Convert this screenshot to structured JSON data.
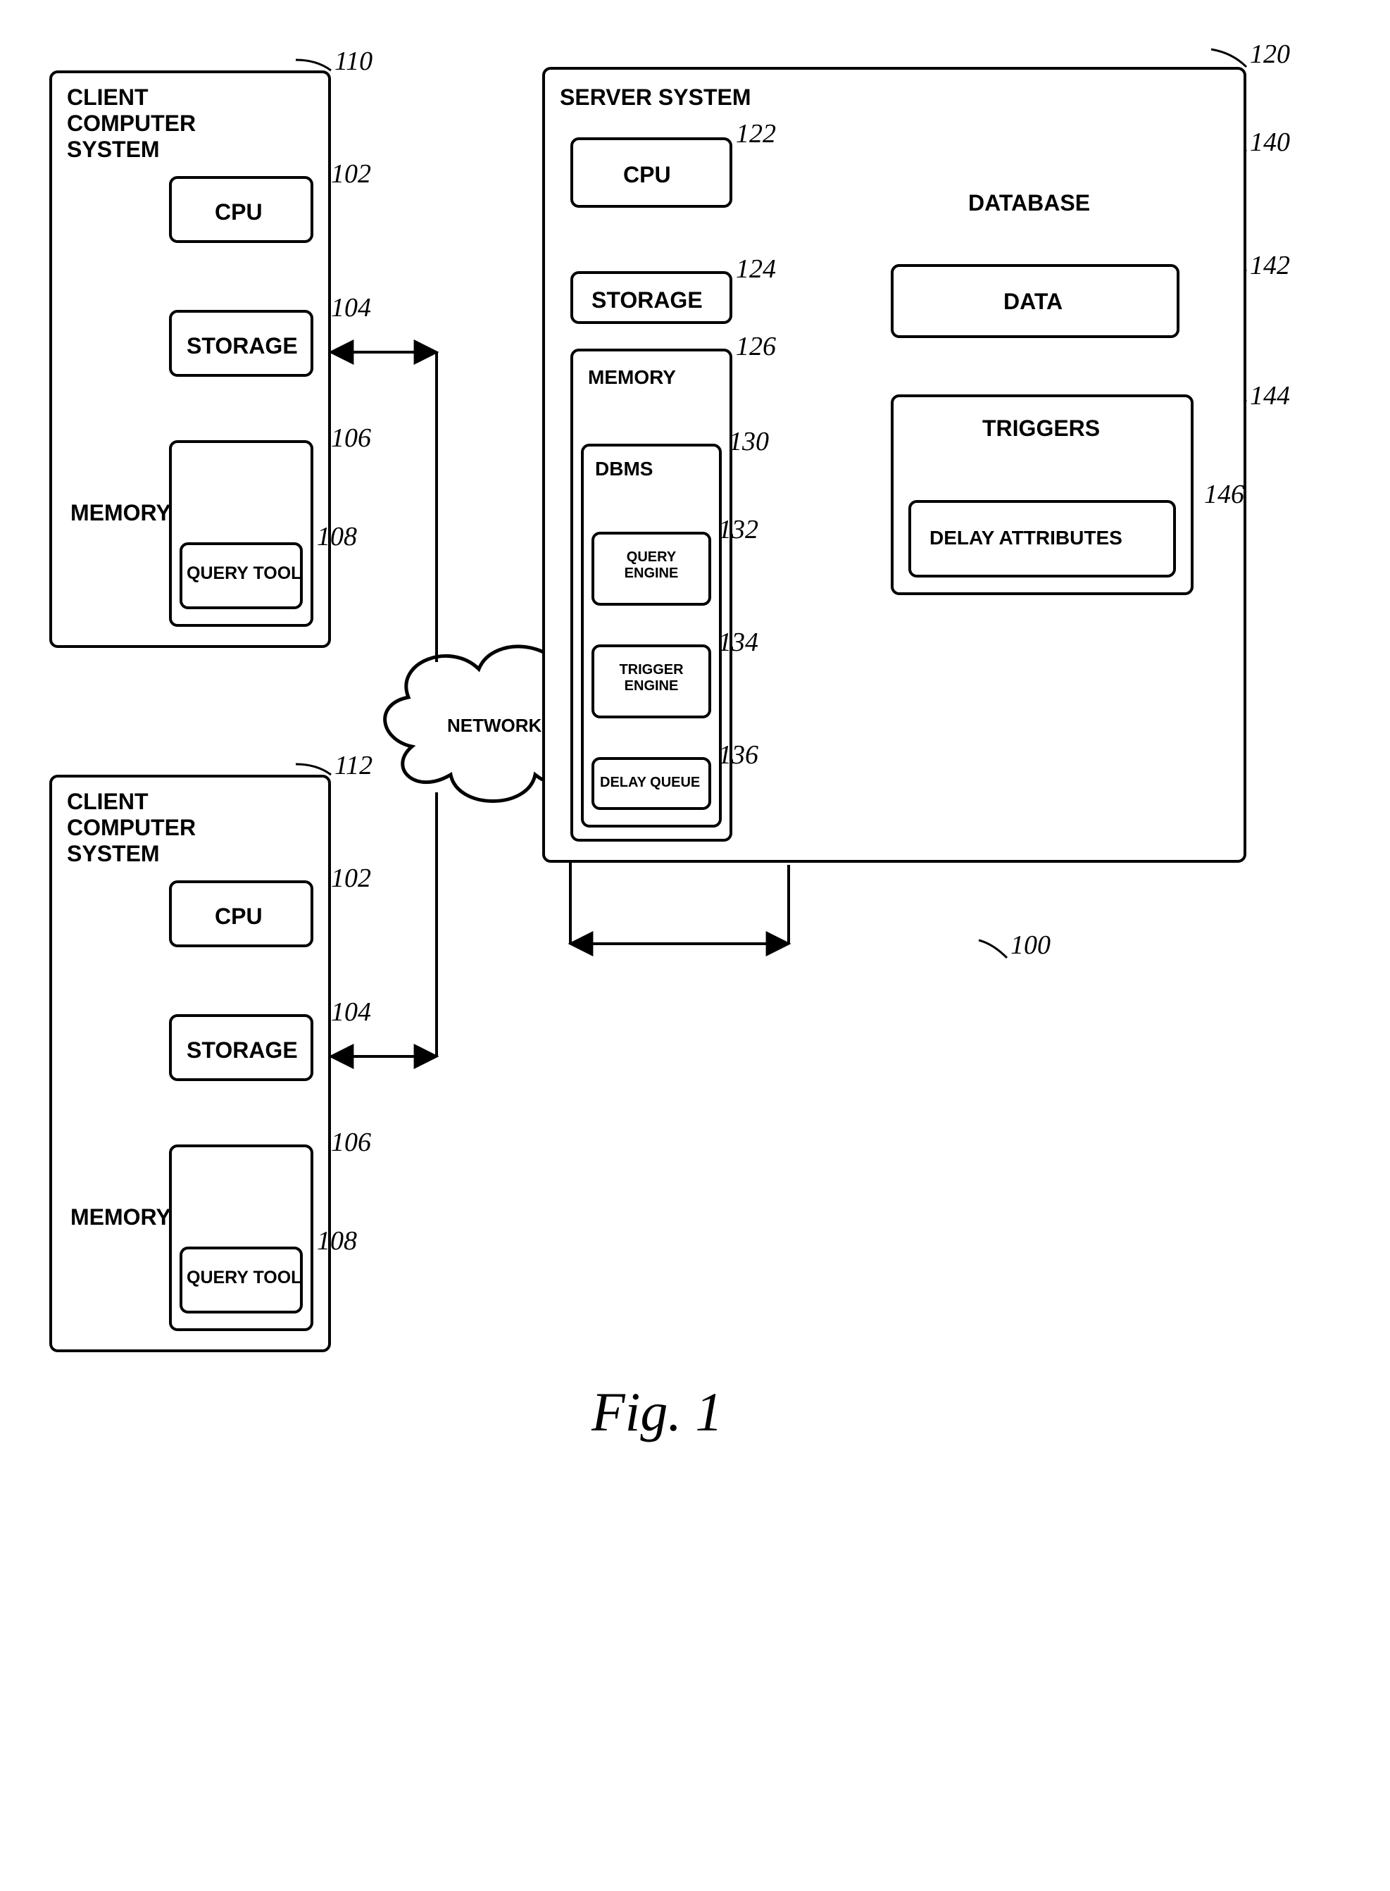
{
  "client1": {
    "title": "CLIENT\nCOMPUTER\nSYSTEM",
    "cpu": "CPU",
    "storage": "STORAGE",
    "memory": "MEMORY",
    "querytool": "QUERY TOOL",
    "ref_sys": "110",
    "ref_cpu": "102",
    "ref_storage": "104",
    "ref_memory": "106",
    "ref_qtool": "108"
  },
  "client2": {
    "title": "CLIENT\nCOMPUTER\nSYSTEM",
    "cpu": "CPU",
    "storage": "STORAGE",
    "memory": "MEMORY",
    "querytool": "QUERY TOOL",
    "ref_sys": "112",
    "ref_cpu": "102",
    "ref_storage": "104",
    "ref_memory": "106",
    "ref_qtool": "108"
  },
  "server": {
    "title": "SERVER SYSTEM",
    "cpu": "CPU",
    "storage": "STORAGE",
    "memory": "MEMORY",
    "dbms": "DBMS",
    "query_engine": "QUERY ENGINE",
    "trigger_engine": "TRIGGER ENGINE",
    "delay_queue": "DELAY QUEUE",
    "ref_sys": "120",
    "ref_cpu": "122",
    "ref_storage": "124",
    "ref_memory": "126",
    "ref_dbms": "130",
    "ref_qe": "132",
    "ref_te": "134",
    "ref_dq": "136"
  },
  "database": {
    "title": "DATABASE",
    "data": "DATA",
    "triggers": "TRIGGERS",
    "delay_attr": "DELAY ATTRIBUTES",
    "ref_db": "140",
    "ref_data": "142",
    "ref_trig": "144",
    "ref_dattr": "146"
  },
  "network": "NETWORK",
  "ref_overall": "100",
  "figure": "Fig. 1"
}
